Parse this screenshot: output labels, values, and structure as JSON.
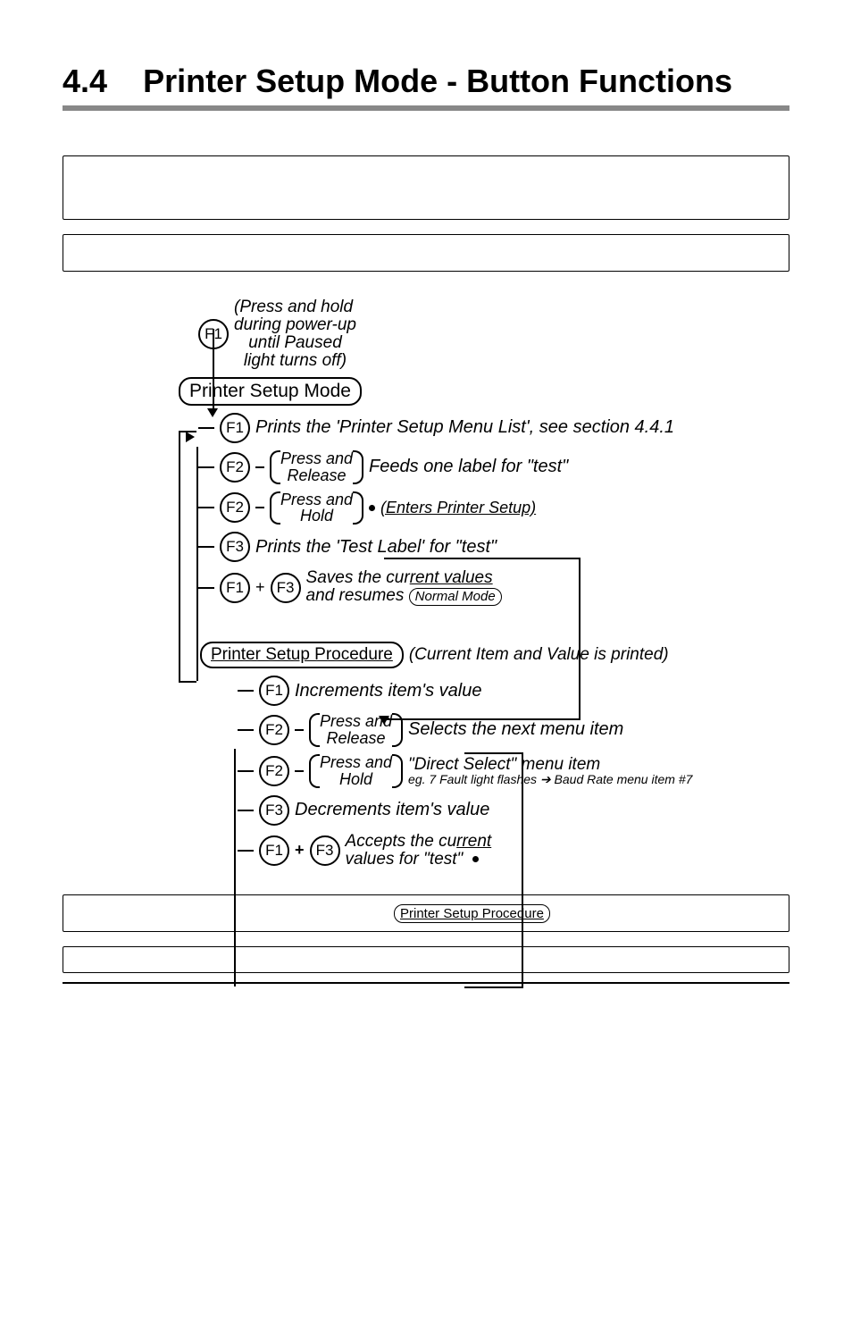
{
  "heading": {
    "number": "4.4",
    "title": "Printer Setup Mode - Button Functions"
  },
  "top": {
    "f1_hold": [
      "(Press and hold",
      "during power-up",
      "until Paused",
      "light turns off)"
    ],
    "mode_pill": "Printer Setup Mode"
  },
  "setup_actions": {
    "f1": "Prints the 'Printer Setup Menu List', see section 4.4.1",
    "f2_release_paren": [
      "Press and",
      "Release"
    ],
    "f2_release_text": "Feeds one label for \"test\"",
    "f2_hold_paren": [
      "Press and",
      "Hold"
    ],
    "f2_hold_text": "(Enters Printer Setup)",
    "f3": "Prints the 'Test Label' for \"test\"",
    "f1f3_line1": "Saves the current values",
    "f1f3_line2": "and resumes",
    "normal_mode_pill": "Normal Mode"
  },
  "procedure": {
    "pill": "Printer Setup Procedure",
    "header_note": "(Current Item and Value is printed)",
    "f1": "Increments item's value",
    "f2_release_paren": [
      "Press and",
      "Release"
    ],
    "f2_release_text": "Selects the next menu item",
    "f2_hold_paren": [
      "Press and",
      "Hold"
    ],
    "f2_hold_text": "\"Direct Select\" menu item",
    "f2_hold_sub": "eg. 7 Fault light flashes ➔ Baud Rate menu item #7",
    "f3": "Decrements item's value",
    "f1f3_line1": "Accepts the current",
    "f1f3_line2": "values for \"test\""
  },
  "bottom_pill": "Printer Setup Procedure",
  "labels": {
    "F1": "F1",
    "F2": "F2",
    "F3": "F3",
    "plus": "+"
  }
}
